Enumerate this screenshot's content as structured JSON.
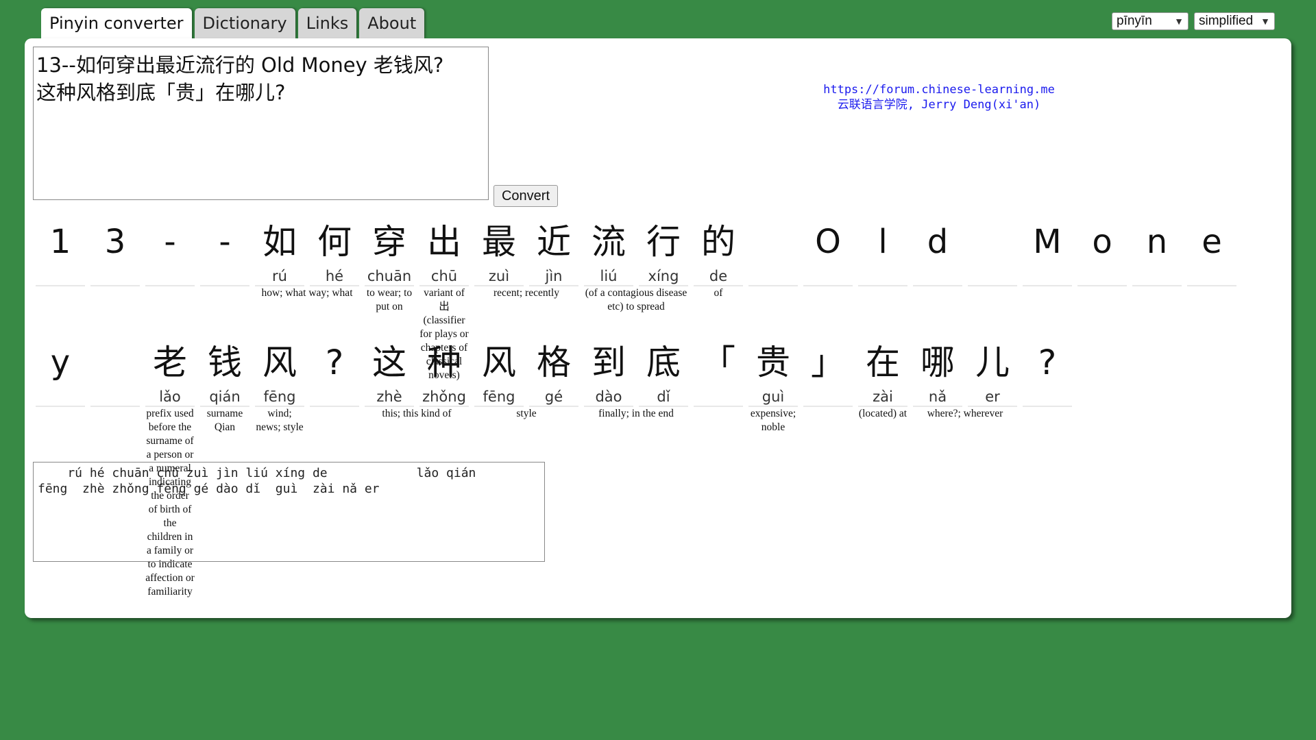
{
  "tabs": [
    {
      "label": "Pinyin converter"
    },
    {
      "label": "Dictionary"
    },
    {
      "label": "Links"
    },
    {
      "label": "About"
    }
  ],
  "selects": {
    "romanization": "pīnyīn",
    "script": "simplified"
  },
  "input": {
    "text": "13--如何穿出最近流行的 Old Money 老钱风?\n这种风格到底「贵」在哪儿?"
  },
  "convert_label": "Convert",
  "credit": {
    "url": "https://forum.chinese-learning.me",
    "line2": "云联语言学院, Jerry Deng(xi'an)"
  },
  "row1": [
    {
      "han": "1",
      "py": ""
    },
    {
      "han": "3",
      "py": ""
    },
    {
      "han": "-",
      "py": ""
    },
    {
      "han": "-",
      "py": ""
    },
    {
      "han": "如",
      "py": "rú"
    },
    {
      "han": "何",
      "py": "hé"
    },
    {
      "han": "穿",
      "py": "chuān"
    },
    {
      "han": "出",
      "py": "chū"
    },
    {
      "han": "最",
      "py": "zuì"
    },
    {
      "han": "近",
      "py": "jìn"
    },
    {
      "han": "流",
      "py": "liú"
    },
    {
      "han": "行",
      "py": "xíng"
    },
    {
      "han": "的",
      "py": "de"
    },
    {
      "han": "",
      "py": ""
    },
    {
      "han": "O",
      "py": ""
    },
    {
      "han": "l",
      "py": ""
    },
    {
      "han": "d",
      "py": ""
    },
    {
      "han": "",
      "py": ""
    },
    {
      "han": "M",
      "py": ""
    },
    {
      "han": "o",
      "py": ""
    },
    {
      "han": "n",
      "py": ""
    },
    {
      "han": "e",
      "py": ""
    }
  ],
  "row1_defs": {
    "ruhe": "how; what way; what",
    "chuan": "to wear; to put on",
    "chu": "variant of 出 (classifier for plays or chapters of classical novels)",
    "zuijin": "recent; recently",
    "liuxing": "(of a contagious disease etc) to spread",
    "de": "of"
  },
  "row2": [
    {
      "han": "y",
      "py": ""
    },
    {
      "han": "",
      "py": ""
    },
    {
      "han": "老",
      "py": "lǎo"
    },
    {
      "han": "钱",
      "py": "qián"
    },
    {
      "han": "风",
      "py": "fēng"
    },
    {
      "han": "?",
      "py": ""
    },
    {
      "han": "这",
      "py": "zhè"
    },
    {
      "han": "种",
      "py": "zhǒng"
    },
    {
      "han": "风",
      "py": "fēng"
    },
    {
      "han": "格",
      "py": "gé"
    },
    {
      "han": "到",
      "py": "dào"
    },
    {
      "han": "底",
      "py": "dǐ"
    },
    {
      "han": "「",
      "py": ""
    },
    {
      "han": "贵",
      "py": "guì"
    },
    {
      "han": "」",
      "py": ""
    },
    {
      "han": "在",
      "py": "zài"
    },
    {
      "han": "哪",
      "py": "nǎ"
    },
    {
      "han": "儿",
      "py": "er"
    },
    {
      "han": "?",
      "py": ""
    }
  ],
  "row2_defs": {
    "lao": "prefix used before the surname of a person or a numeral indicating the order of birth of the children in a family or to indicate affection or familiarity",
    "qian": "surname Qian",
    "feng": "wind; news; style",
    "zhezhong": "this; this kind of",
    "fengge": "style",
    "daodi": "finally; in the end",
    "gui": "expensive; noble",
    "zai": "(located) at",
    "naer": "where?; wherever"
  },
  "output": {
    "text": "    rú hé chuān chū zuì jìn liú xíng de            lǎo qián\nfēng  zhè zhǒng fēng gé dào dǐ  guì  zài nǎ er"
  }
}
